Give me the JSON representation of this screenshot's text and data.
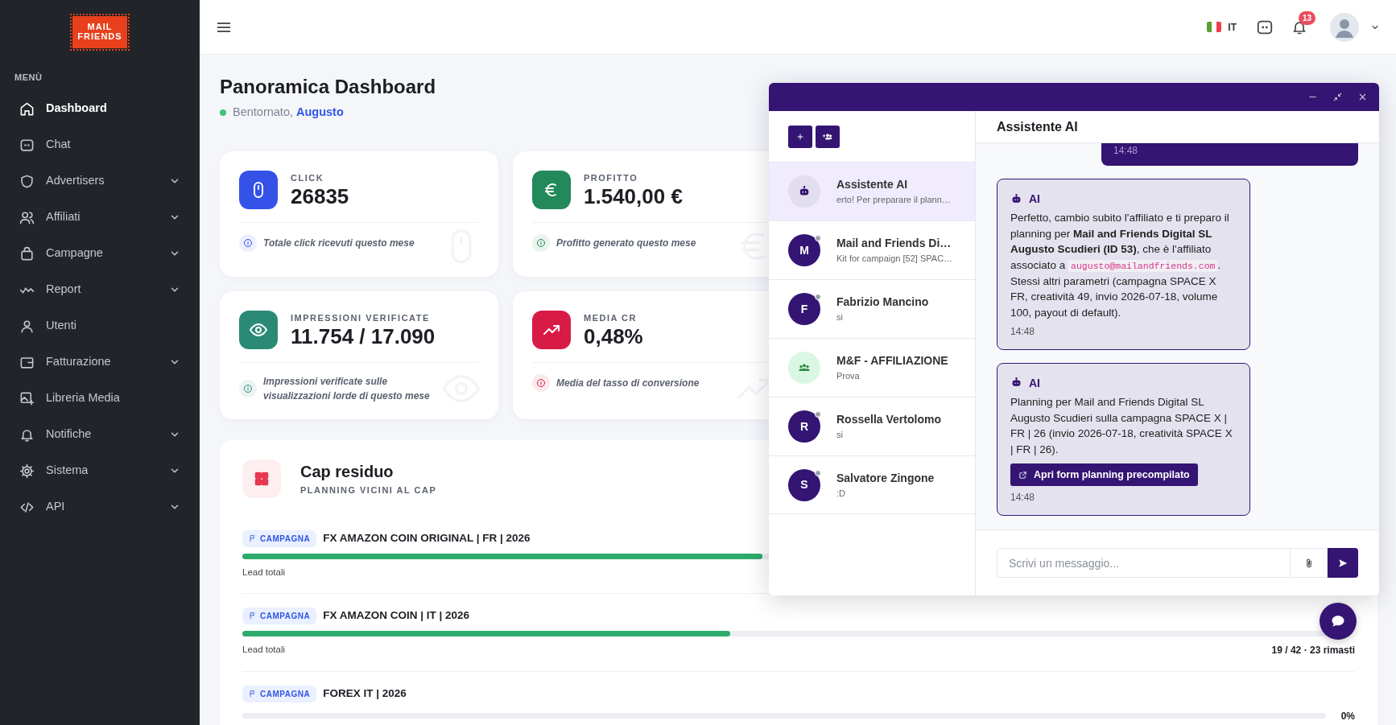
{
  "sidebar": {
    "logo": {
      "line1": "MAIL",
      "line2": "FRIENDS"
    },
    "menu_label": "MENÙ",
    "items": [
      {
        "label": "Dashboard",
        "selected": true,
        "expandable": false
      },
      {
        "label": "Chat",
        "selected": false,
        "expandable": false
      },
      {
        "label": "Advertisers",
        "selected": false,
        "expandable": true
      },
      {
        "label": "Affiliati",
        "selected": false,
        "expandable": true
      },
      {
        "label": "Campagne",
        "selected": false,
        "expandable": true
      },
      {
        "label": "Report",
        "selected": false,
        "expandable": true
      },
      {
        "label": "Utenti",
        "selected": false,
        "expandable": false
      },
      {
        "label": "Fatturazione",
        "selected": false,
        "expandable": true
      },
      {
        "label": "Libreria Media",
        "selected": false,
        "expandable": false
      },
      {
        "label": "Notifiche",
        "selected": false,
        "expandable": true
      },
      {
        "label": "Sistema",
        "selected": false,
        "expandable": true
      },
      {
        "label": "API",
        "selected": false,
        "expandable": true
      }
    ]
  },
  "header": {
    "language": "IT",
    "notifications_count": "13"
  },
  "page": {
    "title": "Panoramica Dashboard",
    "greeting": "Bentornato,",
    "user": "Augusto"
  },
  "stats": [
    {
      "label": "CLICK",
      "value": "26835",
      "note": "Totale click ricevuti questo mese",
      "color": "#3451e8"
    },
    {
      "label": "PROFITTO",
      "value": "1.540,00 €",
      "note": "Profitto generato questo mese",
      "color": "#23895a"
    },
    {
      "label": "IMPRESSIONI VERIFICATE",
      "value": "11.754 / 17.090",
      "note": "Impressioni verificate sulle visualizzazioni lorde di questo mese",
      "color": "#2a8a76"
    },
    {
      "label": "MEDIA CR",
      "value": "0,48%",
      "note": "Media del tasso di conversione",
      "color": "#d81b45"
    }
  ],
  "cap": {
    "title": "Cap residuo",
    "subtitle": "PLANNING VICINI AL CAP",
    "rows": [
      {
        "badge": "CAMPAGNA",
        "name": "FX AMAZON COIN ORIGINAL | FR | 2026",
        "level": 0.48,
        "caption": "Lead totali"
      },
      {
        "badge": "CAMPAGNA",
        "name": "FX AMAZON COIN | IT | 2026",
        "level": 0.45,
        "caption": "Lead totali",
        "count": "19 / 42 · 23 rimasti"
      },
      {
        "badge": "CAMPAGNA",
        "name": "FOREX IT | 2026",
        "level": 0,
        "percent": "0%"
      }
    ]
  },
  "chat": {
    "contacts": [
      {
        "kind": "bot",
        "name": "Assistente AI",
        "preview": "erto! Per preparare il plann…",
        "selected": true
      },
      {
        "kind": "person",
        "initial": "M",
        "name": "Mail and Friends Di…",
        "preview": "Kit for campaign [52] SPAC…",
        "online": false,
        "selected": false
      },
      {
        "kind": "person",
        "initial": "F",
        "name": "Fabrizio Mancino",
        "preview": "si",
        "online": false,
        "selected": false
      },
      {
        "kind": "group",
        "name": "M&F - AFFILIAZIONE",
        "preview": "Prova",
        "selected": false
      },
      {
        "kind": "person",
        "initial": "R",
        "name": "Rossella Vertolomo",
        "preview": "si",
        "online": false,
        "selected": false
      },
      {
        "kind": "person",
        "initial": "S",
        "name": "Salvatore Zingone",
        "preview": ":D",
        "online": false,
        "selected": false
      }
    ],
    "title": "Assistente AI",
    "messages": [
      {
        "kind": "user",
        "time": "14:48"
      },
      {
        "kind": "ai",
        "sender": "AI",
        "text": "Perfetto, cambio subito l'affiliato e ti preparo il planning per **Mail and Friends Digital SL Augusto Scudieri (ID 53)**, che è l'affiliato associato a ",
        "code": "augusto@mailandfriends.com",
        "text_after": ". Stessi altri parametri (campagna SPACE X FR, creatività 49, invio 2026-07-18, volume 100, payout di default).",
        "time": "14:48"
      },
      {
        "kind": "ai",
        "sender": "AI",
        "text": "Planning per Mail and Friends Digital SL Augusto Scudieri sulla campagna SPACE X | FR | 26 (invio 2026-07-18, creatività SPACE X | FR | 26).",
        "action": "Apri form planning precompilato",
        "time": "14:48"
      }
    ],
    "input_placeholder": "Scrivi un messaggio..."
  }
}
